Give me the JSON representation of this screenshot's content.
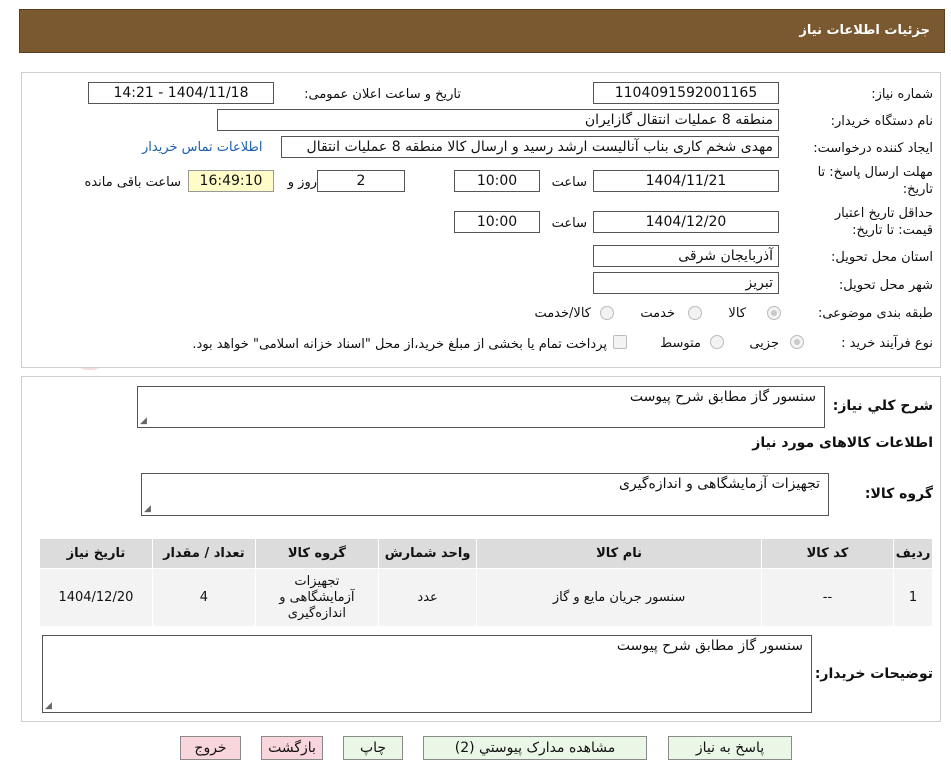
{
  "header": {
    "title": "جزئیات اطلاعات نیاز"
  },
  "watermark": {
    "text": "AriaTender.neT"
  },
  "form": {
    "need_number": {
      "label": "شماره نیاز:",
      "value": "1104091592001165"
    },
    "announce": {
      "label": "تاریخ و ساعت اعلان عمومی:",
      "value": "1404/11/18 - 14:21"
    },
    "buyer_org": {
      "label": "نام دستگاه خریدار:",
      "value": "منطقه 8 عملیات انتقال گازایران"
    },
    "requester": {
      "label": "ایجاد کننده درخواست:",
      "value": "مهدی شخم کاری بناب آنالیست ارشد رسید و ارسال کالا منطقه 8 عملیات انتقال",
      "contact_link": "اطلاعات تماس خریدار"
    },
    "deadline": {
      "label_line1": "مهلت ارسال پاسخ: تا",
      "label_line2": "تاریخ:",
      "date": "1404/11/21",
      "time_label": "ساعت",
      "time": "10:00",
      "days": "2",
      "days_label": "روز و",
      "remaining": "16:49:10",
      "remaining_label": "ساعت باقی مانده"
    },
    "validity": {
      "label_line1": "حداقل تاریخ اعتبار",
      "label_line2": "قیمت: تا تاریخ:",
      "date": "1404/12/20",
      "time_label": "ساعت",
      "time": "10:00"
    },
    "province": {
      "label": "استان محل تحویل:",
      "value": "آذربایجان شرقی"
    },
    "city": {
      "label": "شهر محل تحویل:",
      "value": "تبریز"
    },
    "category": {
      "label": "طبقه بندی موضوعی:",
      "options": [
        "کالا",
        "خدمت",
        "کالا/خدمت"
      ],
      "selected": "کالا"
    },
    "process": {
      "label": "نوع فرآیند خرید :",
      "options": [
        "جزیی",
        "متوسط"
      ],
      "selected": "جزیی",
      "treasury_note": "پرداخت تمام یا بخشی از مبلغ خرید،از محل \"اسناد خزانه اسلامی\" خواهد بود."
    }
  },
  "summary": {
    "label": "شرح کلي نياز:",
    "value": "سنسور گاز مطابق شرح پیوست",
    "goods_heading": "اطلاعات کالاهای مورد نیاز",
    "group_label": "گروه کالا:",
    "group_value": "تجهیزات آزمایشگاهی و اندازه‌گیری"
  },
  "table": {
    "headers": [
      "ردیف",
      "کد کالا",
      "نام کالا",
      "واحد شمارش",
      "گروه کالا",
      "تعداد / مقدار",
      "تاریخ نیاز"
    ],
    "rows": [
      [
        "1",
        "--",
        "سنسور جریان مایع و گاز",
        "عدد",
        "تجهیزات آزمایشگاهی و اندازه‌گیری",
        "4",
        "1404/12/20"
      ]
    ]
  },
  "buyer_notes": {
    "label": "توضیحات خریدار:",
    "value": "سنسور گاز مطابق شرح پیوست"
  },
  "buttons": {
    "reply": "پاسخ به نیاز",
    "attachments": "مشاهده مدارک پیوستي (2)",
    "print": "چاپ",
    "back": "بازگشت",
    "exit": "خروج"
  },
  "colors": {
    "header_bg": "#7b5930",
    "link": "#1a5fb4",
    "green_button": "#eaf7e6",
    "red_button": "#f9d6dc"
  }
}
